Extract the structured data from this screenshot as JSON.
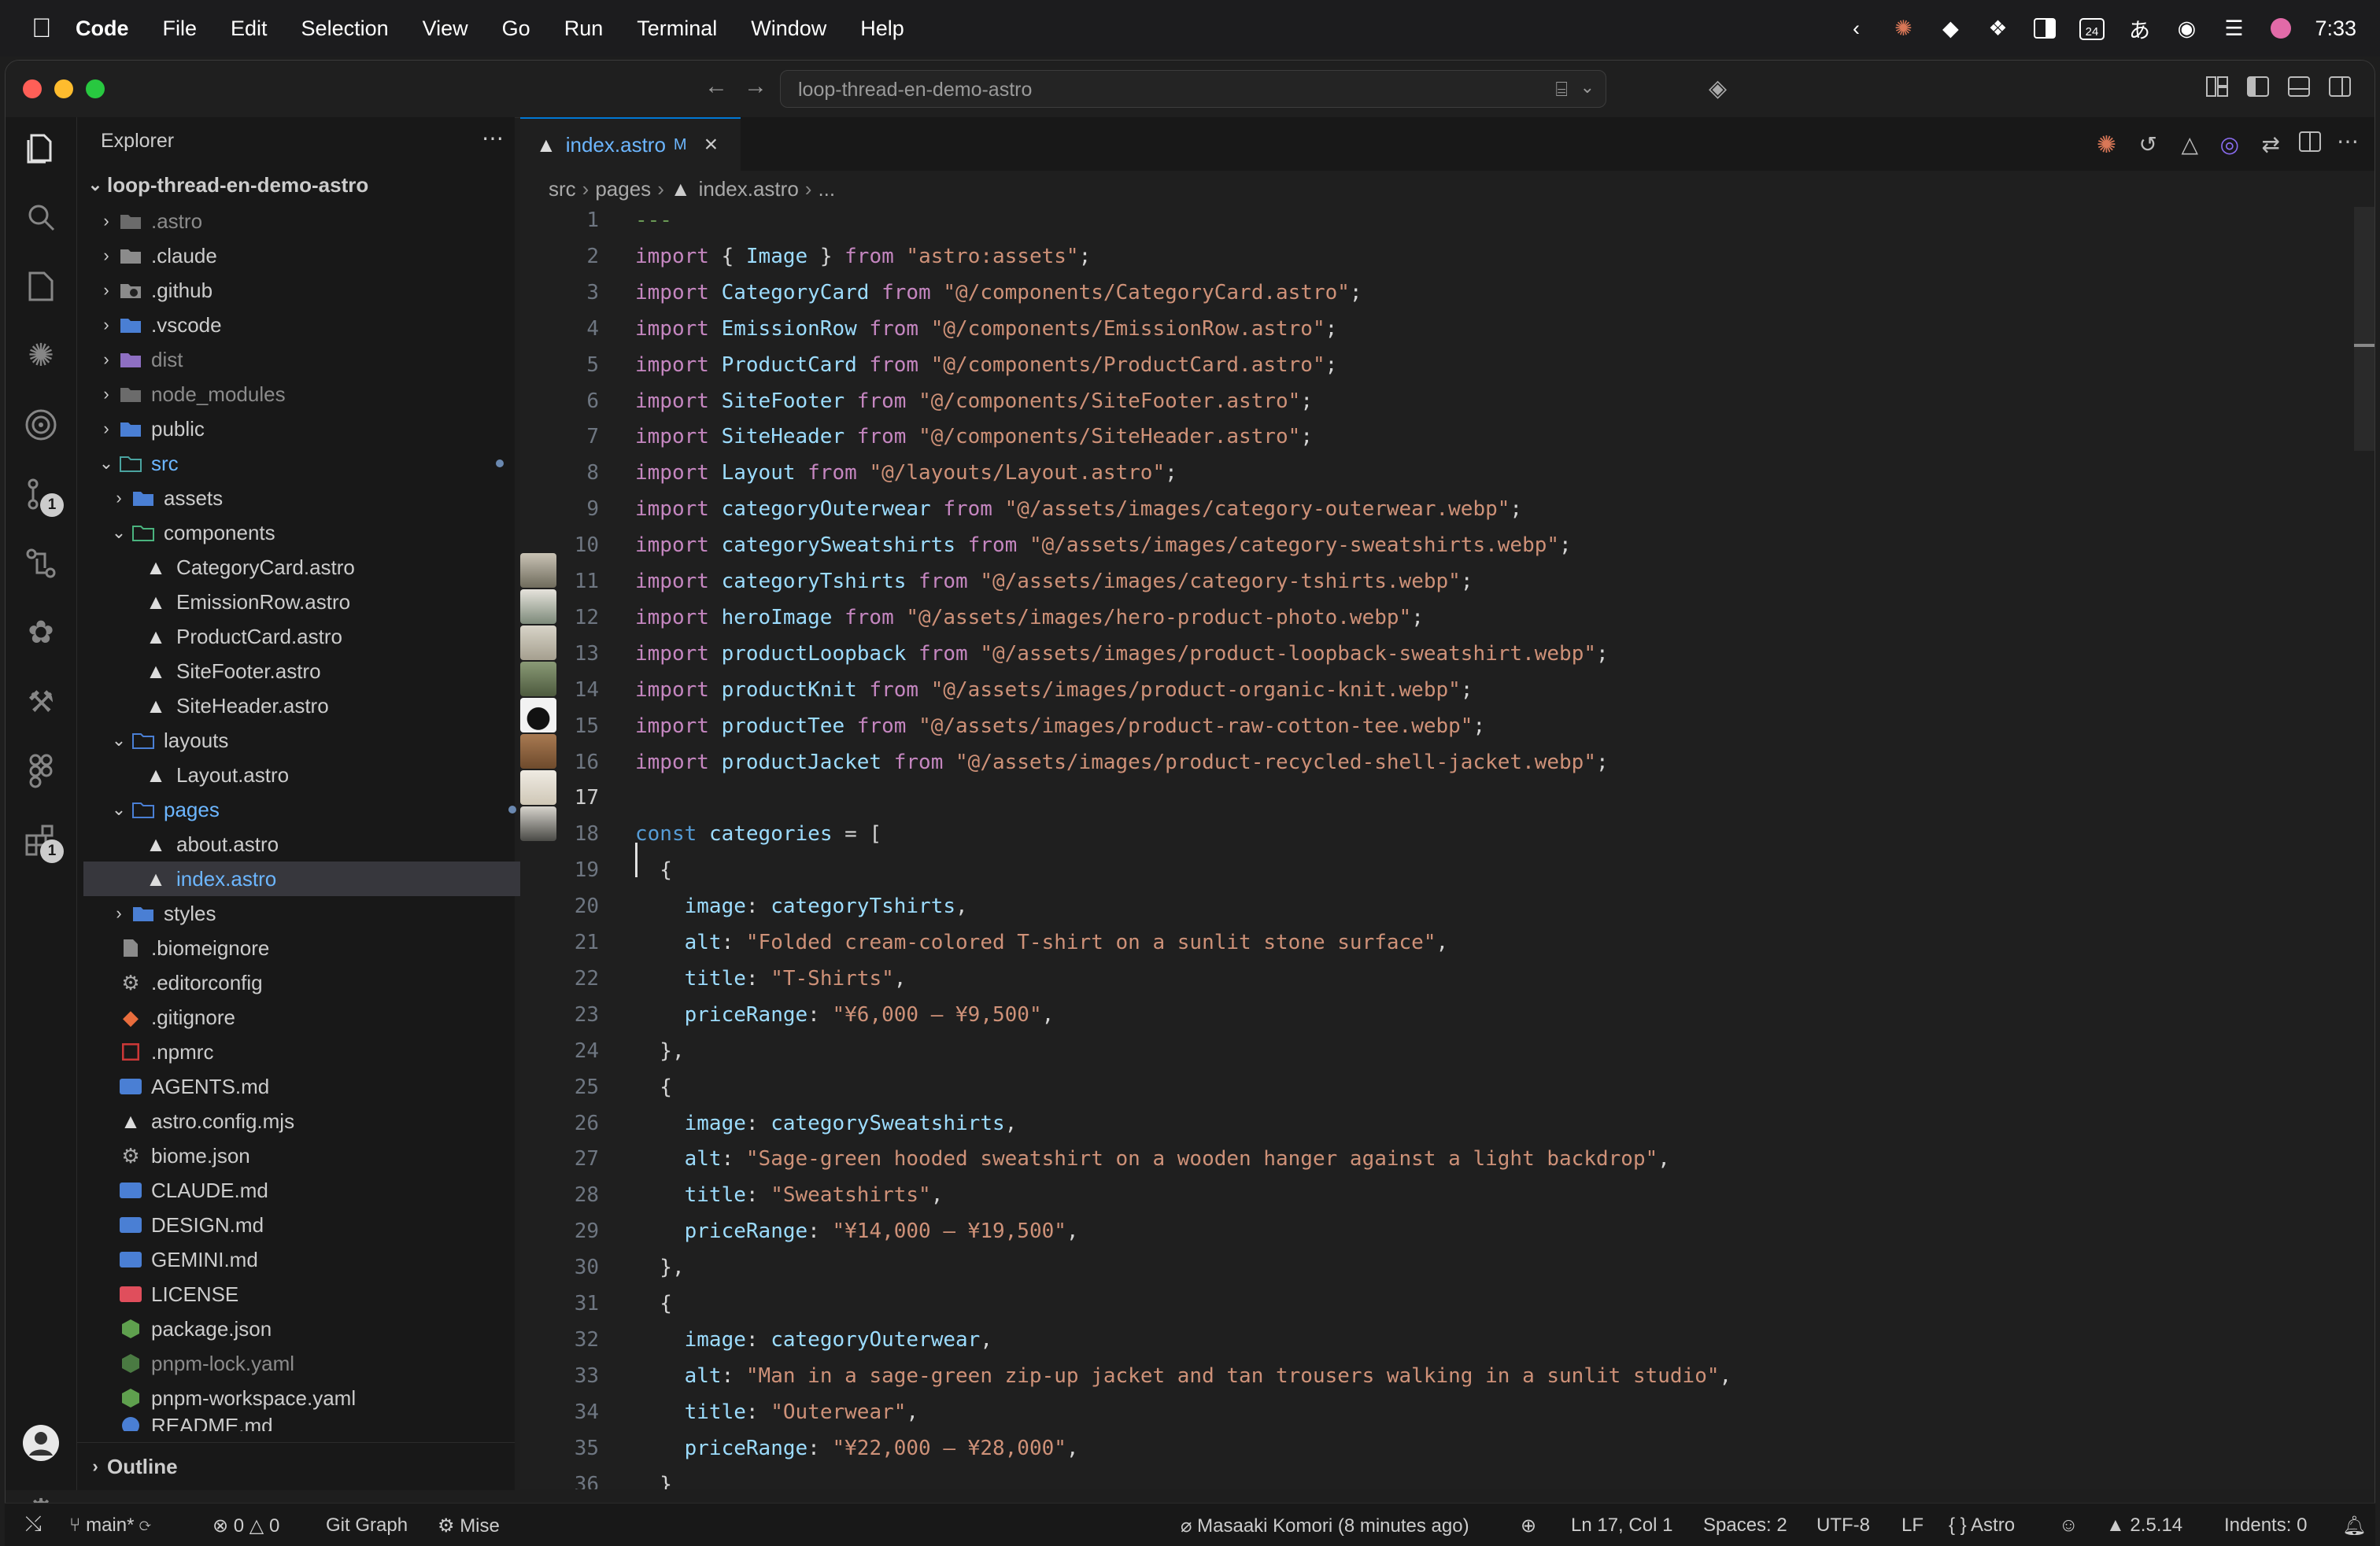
{
  "menubar": {
    "items": [
      "Code",
      "File",
      "Edit",
      "Selection",
      "View",
      "Go",
      "Run",
      "Terminal",
      "Window",
      "Help"
    ],
    "clock": "7:33",
    "calendar_day": "24"
  },
  "titlebar": {
    "search": "loop-thread-en-demo-astro"
  },
  "activity": {
    "source_control_badge": "1",
    "extensions_badge": "1"
  },
  "explorer": {
    "title": "Explorer",
    "root": "loop-thread-en-demo-astro",
    "items": [
      {
        "label": ".astro"
      },
      {
        "label": ".claude"
      },
      {
        "label": ".github"
      },
      {
        "label": ".vscode"
      },
      {
        "label": "dist"
      },
      {
        "label": "node_modules"
      },
      {
        "label": "public"
      },
      {
        "label": "src"
      },
      {
        "label": "assets"
      },
      {
        "label": "components"
      },
      {
        "label": "CategoryCard.astro"
      },
      {
        "label": "EmissionRow.astro"
      },
      {
        "label": "ProductCard.astro"
      },
      {
        "label": "SiteFooter.astro"
      },
      {
        "label": "SiteHeader.astro"
      },
      {
        "label": "layouts"
      },
      {
        "label": "Layout.astro"
      },
      {
        "label": "pages"
      },
      {
        "label": "about.astro"
      },
      {
        "label": "index.astro",
        "badge": "M"
      },
      {
        "label": "styles"
      },
      {
        "label": ".biomeignore"
      },
      {
        "label": ".editorconfig"
      },
      {
        "label": ".gitignore"
      },
      {
        "label": ".npmrc"
      },
      {
        "label": "AGENTS.md"
      },
      {
        "label": "astro.config.mjs"
      },
      {
        "label": "biome.json"
      },
      {
        "label": "CLAUDE.md"
      },
      {
        "label": "DESIGN.md"
      },
      {
        "label": "GEMINI.md"
      },
      {
        "label": "LICENSE"
      },
      {
        "label": "package.json"
      },
      {
        "label": "pnpm-lock.yaml"
      },
      {
        "label": "pnpm-workspace.yaml"
      },
      {
        "label": "README.md"
      }
    ],
    "outline": "Outline"
  },
  "editor": {
    "tab": {
      "label": "index.astro",
      "badge": "M"
    },
    "breadcrumb": [
      "src",
      "pages",
      "index.astro",
      "..."
    ],
    "lines": [
      "---",
      "import { Image } from \"astro:assets\";",
      "import CategoryCard from \"@/components/CategoryCard.astro\";",
      "import EmissionRow from \"@/components/EmissionRow.astro\";",
      "import ProductCard from \"@/components/ProductCard.astro\";",
      "import SiteFooter from \"@/components/SiteFooter.astro\";",
      "import SiteHeader from \"@/components/SiteHeader.astro\";",
      "import Layout from \"@/layouts/Layout.astro\";",
      "import categoryOuterwear from \"@/assets/images/category-outerwear.webp\";",
      "import categorySweatshirts from \"@/assets/images/category-sweatshirts.webp\";",
      "import categoryTshirts from \"@/assets/images/category-tshirts.webp\";",
      "import heroImage from \"@/assets/images/hero-product-photo.webp\";",
      "import productLoopback from \"@/assets/images/product-loopback-sweatshirt.webp\";",
      "import productKnit from \"@/assets/images/product-organic-knit.webp\";",
      "import productTee from \"@/assets/images/product-raw-cotton-tee.webp\";",
      "import productJacket from \"@/assets/images/product-recycled-shell-jacket.webp\";",
      "",
      "const categories = [",
      "  {",
      "    image: categoryTshirts,",
      "    alt: \"Folded cream-colored T-shirt on a sunlit stone surface\",",
      "    title: \"T-Shirts\",",
      "    priceRange: \"¥6,000 – ¥9,500\",",
      "  },",
      "  {",
      "    image: categorySweatshirts,",
      "    alt: \"Sage-green hooded sweatshirt on a wooden hanger against a light backdrop\",",
      "    title: \"Sweatshirts\",",
      "    priceRange: \"¥14,000 – ¥19,500\",",
      "  },",
      "  {",
      "    image: categoryOuterwear,",
      "    alt: \"Man in a sage-green zip-up jacket and tan trousers walking in a sunlit studio\",",
      "    title: \"Outerwear\",",
      "    priceRange: \"¥22,000 – ¥28,000\",",
      "  }"
    ],
    "current_line": 17
  },
  "status": {
    "branch": "main*",
    "errors": "0",
    "warnings": "0",
    "git_graph": "Git Graph",
    "mise": "Mise",
    "blame": "Masaaki Komori (8 minutes ago)",
    "position": "Ln 17, Col 1",
    "spaces": "Spaces: 2",
    "encoding": "UTF-8",
    "eol": "LF",
    "language": "Astro",
    "astro_version": "2.5.14",
    "indents": "Indents: 0"
  },
  "colors": {
    "accent": "#0078d4",
    "keyword": "#c586c0",
    "string": "#ce9178",
    "variable": "#9cdcfe"
  }
}
